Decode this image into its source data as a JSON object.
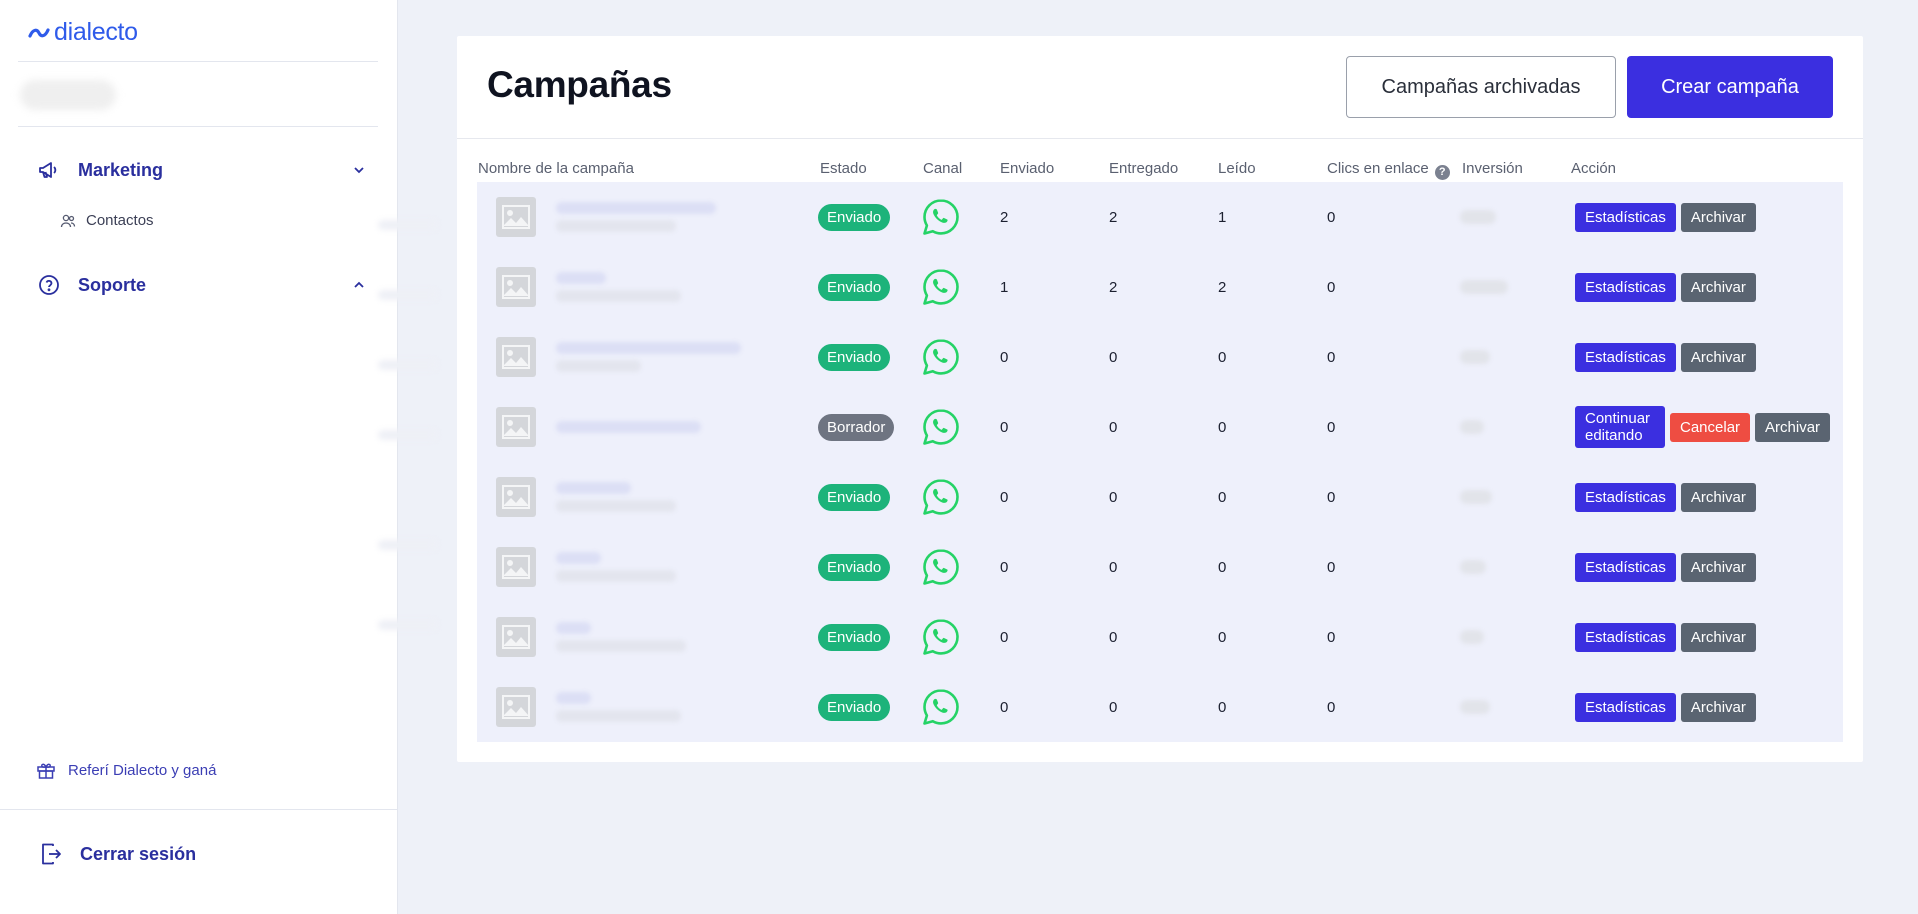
{
  "brand": {
    "name": "dialecto",
    "color": "#2f5bea"
  },
  "sidebar": {
    "marketing": {
      "label": "Marketing",
      "icon": "megaphone-icon"
    },
    "contacts": {
      "label": "Contactos",
      "icon": "users-icon"
    },
    "support": {
      "label": "Soporte",
      "icon": "help-circle-icon"
    },
    "refer": {
      "label": "Referí Dialecto y ganá",
      "icon": "gift-icon"
    },
    "logout": {
      "label": "Cerrar sesión",
      "icon": "logout-icon"
    }
  },
  "page": {
    "title": "Campañas",
    "archived_button": "Campañas archivadas",
    "create_button": "Crear campaña"
  },
  "table": {
    "headers": {
      "name": "Nombre de la campaña",
      "status": "Estado",
      "channel": "Canal",
      "sent": "Enviado",
      "delivered": "Entregado",
      "read": "Leído",
      "clicks": "Clics en enlace",
      "investment": "Inversión",
      "action": "Acción"
    },
    "rows": [
      {
        "status": "Enviado",
        "sent": "2",
        "delivered": "2",
        "read": "1",
        "clicks": "0"
      },
      {
        "status": "Enviado",
        "sent": "1",
        "delivered": "2",
        "read": "2",
        "clicks": "0"
      },
      {
        "status": "Enviado",
        "sent": "0",
        "delivered": "0",
        "read": "0",
        "clicks": "0"
      },
      {
        "status": "Borrador",
        "sent": "0",
        "delivered": "0",
        "read": "0",
        "clicks": "0"
      },
      {
        "status": "Enviado",
        "sent": "0",
        "delivered": "0",
        "read": "0",
        "clicks": "0"
      },
      {
        "status": "Enviado",
        "sent": "0",
        "delivered": "0",
        "read": "0",
        "clicks": "0"
      },
      {
        "status": "Enviado",
        "sent": "0",
        "delivered": "0",
        "read": "0",
        "clicks": "0"
      },
      {
        "status": "Enviado",
        "sent": "0",
        "delivered": "0",
        "read": "0",
        "clicks": "0"
      }
    ],
    "actions": {
      "stats": "Estadísticas",
      "archive": "Archivar",
      "continue_line1": "Continuar",
      "continue_line2": "editando",
      "cancel": "Cancelar"
    },
    "channel_icon": "whatsapp-icon"
  },
  "colors": {
    "accent": "#3b2fe0",
    "sent_badge": "#1cb37a",
    "draft_badge": "#6e7481",
    "cancel": "#ee4d42",
    "archive": "#5a6471",
    "whatsapp": "#25d366"
  }
}
